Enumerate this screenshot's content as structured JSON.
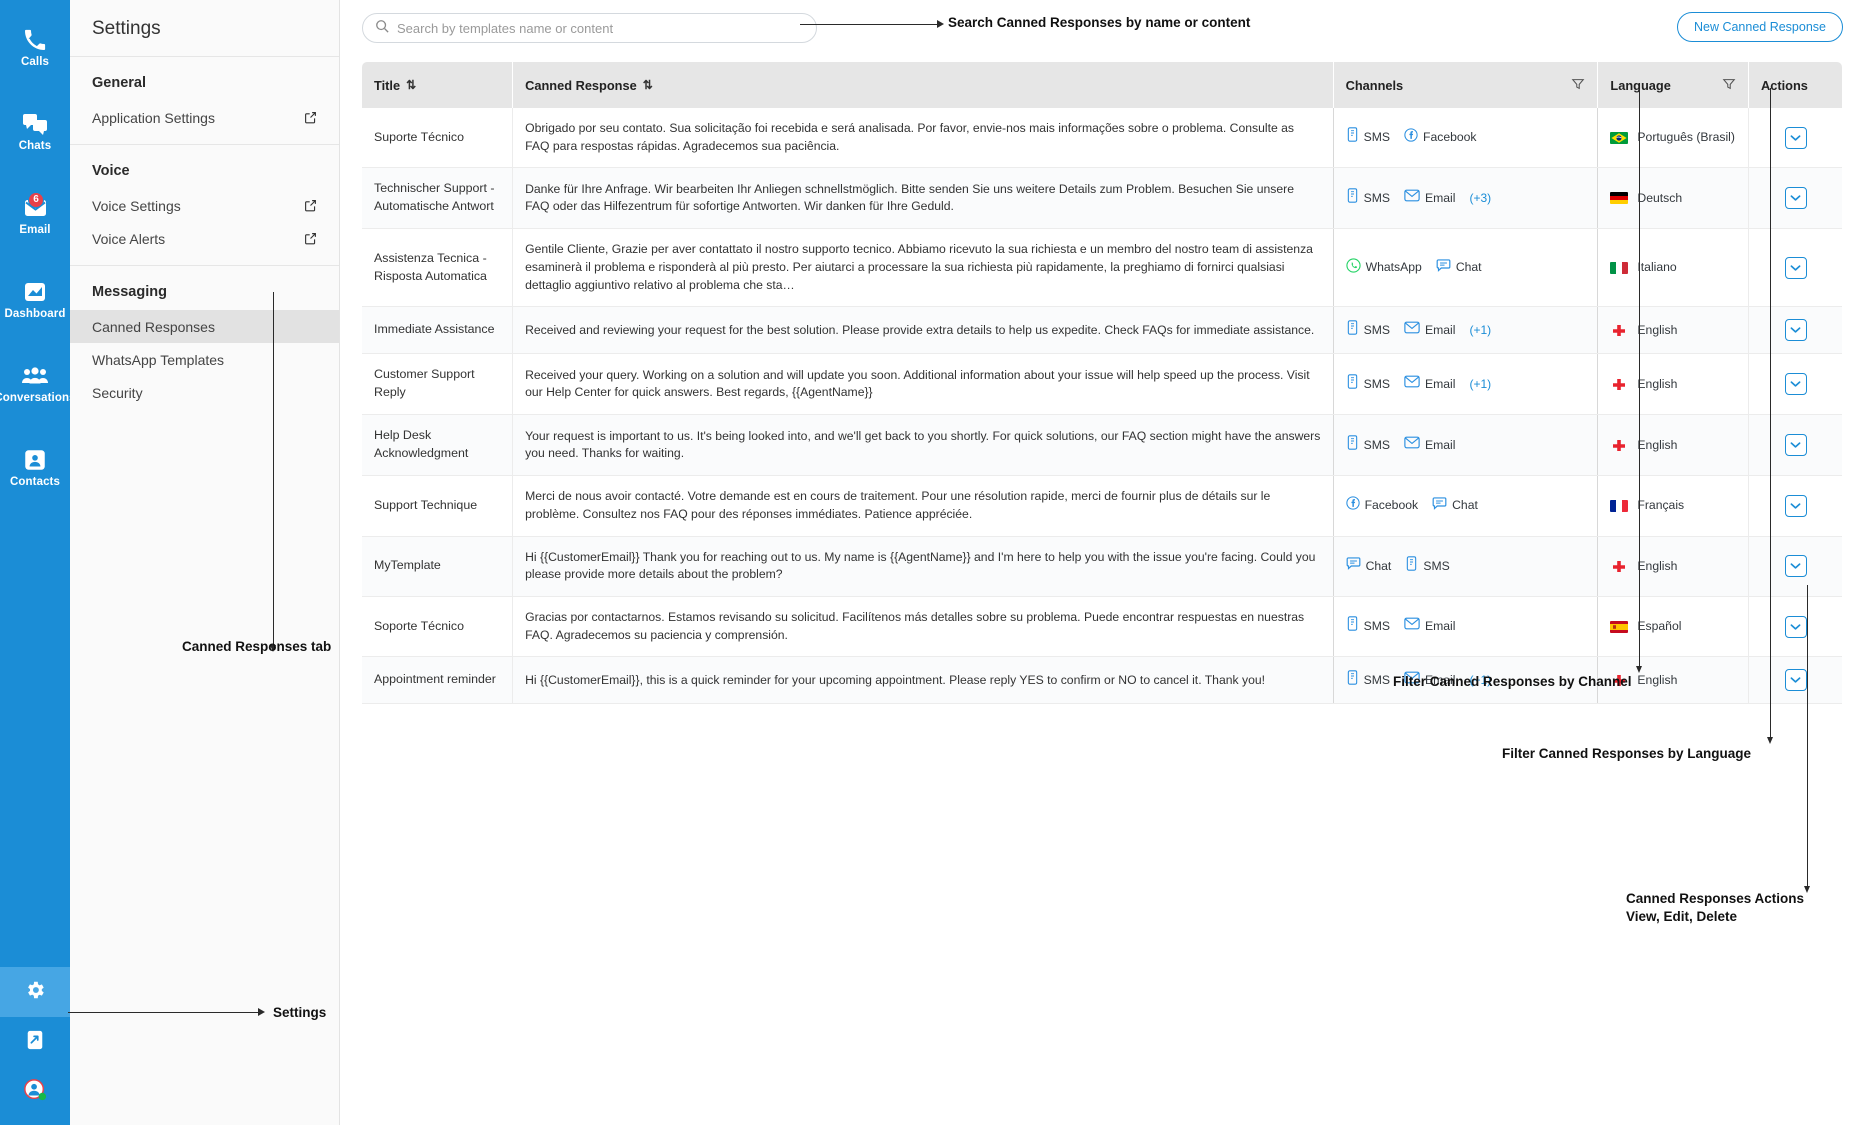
{
  "rail": {
    "items": [
      {
        "label": "Calls",
        "icon": "phone-icon",
        "badge": null
      },
      {
        "label": "Chats",
        "icon": "chat-bubbles-icon",
        "badge": null
      },
      {
        "label": "Email",
        "icon": "envelope-icon",
        "badge": "6"
      },
      {
        "label": "Dashboard",
        "icon": "dashboard-icon",
        "badge": null
      },
      {
        "label": "Conversations",
        "icon": "people-icon",
        "badge": null
      },
      {
        "label": "Contacts",
        "icon": "contact-card-icon",
        "badge": null
      }
    ],
    "bottom": [
      {
        "icon": "gear-icon",
        "name": "settings"
      },
      {
        "icon": "logout-icon",
        "name": "logout"
      },
      {
        "icon": "user-avatar-icon",
        "name": "profile"
      }
    ]
  },
  "settings": {
    "title": "Settings",
    "groups": [
      {
        "heading": "General",
        "items": [
          {
            "label": "Application Settings",
            "external": true,
            "selected": false
          }
        ]
      },
      {
        "heading": "Voice",
        "items": [
          {
            "label": "Voice Settings",
            "external": true,
            "selected": false
          },
          {
            "label": "Voice Alerts",
            "external": true,
            "selected": false
          }
        ]
      },
      {
        "heading": "Messaging",
        "items": [
          {
            "label": "Canned Responses",
            "external": false,
            "selected": true
          },
          {
            "label": "WhatsApp Templates",
            "external": false,
            "selected": false
          },
          {
            "label": "Security",
            "external": false,
            "selected": false
          }
        ]
      }
    ]
  },
  "toolbar": {
    "search_placeholder": "Search by templates name or content",
    "search_value": "",
    "search_icon": "search-icon",
    "new_button": "New Canned Response"
  },
  "table": {
    "columns": [
      {
        "label": "Title",
        "sort": true,
        "filter": false
      },
      {
        "label": "Canned Response",
        "sort": true,
        "filter": false
      },
      {
        "label": "Channels",
        "sort": false,
        "filter": true
      },
      {
        "label": "Language",
        "sort": false,
        "filter": true
      },
      {
        "label": "Actions",
        "sort": false,
        "filter": false
      }
    ],
    "rows": [
      {
        "title": "Suporte Técnico",
        "response": "Obrigado por seu contato. Sua solicitação foi recebida e será analisada. Por favor, envie-nos mais informações sobre o problema. Consulte as FAQ para respostas rápidas. Agradecemos sua paciência.",
        "channels": [
          {
            "label": "SMS",
            "icon": "sms-icon"
          },
          {
            "label": "Facebook",
            "icon": "facebook-icon"
          }
        ],
        "more": "",
        "language": "Português (Brasil)",
        "flag": "br"
      },
      {
        "title": "Technischer Support - Automatische Antwort",
        "response": "Danke für Ihre Anfrage. Wir bearbeiten Ihr Anliegen schnellstmöglich. Bitte senden Sie uns weitere Details zum Problem. Besuchen Sie unsere FAQ oder das Hilfezentrum für sofortige Antworten. Wir danken für Ihre Geduld.",
        "channels": [
          {
            "label": "SMS",
            "icon": "sms-icon"
          },
          {
            "label": "Email",
            "icon": "email-icon"
          }
        ],
        "more": "(+3)",
        "language": "Deutsch",
        "flag": "de"
      },
      {
        "title": "Assistenza Tecnica - Risposta Automatica",
        "response": "Gentile Cliente, Grazie per aver contattato il nostro supporto tecnico. Abbiamo ricevuto la sua richiesta e un membro del nostro team di assistenza esaminerà il problema e risponderà al più presto. Per aiutarci a processare la sua richiesta più rapidamente, la preghiamo di fornirci qualsiasi dettaglio aggiuntivo relativo al problema che sta…",
        "channels": [
          {
            "label": "WhatsApp",
            "icon": "whatsapp-icon"
          },
          {
            "label": "Chat",
            "icon": "chat-icon"
          }
        ],
        "more": "",
        "language": "Italiano",
        "flag": "it"
      },
      {
        "title": "Immediate Assistance",
        "response": "Received and reviewing your request for the best solution. Please provide extra details to help us expedite. Check FAQs for immediate assistance.",
        "channels": [
          {
            "label": "SMS",
            "icon": "sms-icon"
          },
          {
            "label": "Email",
            "icon": "email-icon"
          }
        ],
        "more": "(+1)",
        "language": "English",
        "flag": "en"
      },
      {
        "title": "Customer Support Reply",
        "response": "Received your query. Working on a solution and will update you soon. Additional information about your issue will help speed up the process. Visit our Help Center for quick answers. Best regards, {{AgentName}}",
        "channels": [
          {
            "label": "SMS",
            "icon": "sms-icon"
          },
          {
            "label": "Email",
            "icon": "email-icon"
          }
        ],
        "more": "(+1)",
        "language": "English",
        "flag": "en"
      },
      {
        "title": "Help Desk Acknowledgment",
        "response": "Your request is important to us. It's being looked into, and we'll get back to you shortly. For quick solutions, our FAQ section might have the answers you need. Thanks for waiting.",
        "channels": [
          {
            "label": "SMS",
            "icon": "sms-icon"
          },
          {
            "label": "Email",
            "icon": "email-icon"
          }
        ],
        "more": "",
        "language": "English",
        "flag": "en"
      },
      {
        "title": "Support Technique",
        "response": "Merci de nous avoir contacté. Votre demande est en cours de traitement. Pour une résolution rapide, merci de fournir plus de détails sur le problème. Consultez nos FAQ pour des réponses immédiates. Patience appréciée.",
        "channels": [
          {
            "label": "Facebook",
            "icon": "facebook-icon"
          },
          {
            "label": "Chat",
            "icon": "chat-icon"
          }
        ],
        "more": "",
        "language": "Français",
        "flag": "fr"
      },
      {
        "title": "MyTemplate",
        "response": "Hi {{CustomerEmail}} Thank you for reaching out to us. My name is {{AgentName}} and I'm here to help you with the issue you're facing. Could you please provide more details about the problem?",
        "channels": [
          {
            "label": "Chat",
            "icon": "chat-icon"
          },
          {
            "label": "SMS",
            "icon": "sms-icon"
          }
        ],
        "more": "",
        "language": "English",
        "flag": "en"
      },
      {
        "title": "Soporte Técnico",
        "response": "Gracias por contactarnos. Estamos revisando su solicitud. Facilítenos más detalles sobre su problema. Puede encontrar respuestas en nuestras FAQ. Agradecemos su paciencia y comprensión.",
        "channels": [
          {
            "label": "SMS",
            "icon": "sms-icon"
          },
          {
            "label": "Email",
            "icon": "email-icon"
          }
        ],
        "more": "",
        "language": "Español",
        "flag": "es"
      },
      {
        "title": "Appointment reminder",
        "response": "Hi {{CustomerEmail}}, this is a quick reminder for your upcoming appointment. Please reply YES to confirm or NO to cancel it. Thank you!",
        "channels": [
          {
            "label": "SMS",
            "icon": "sms-icon"
          },
          {
            "label": "Email",
            "icon": "email-icon"
          }
        ],
        "more": "(+1)",
        "language": "English",
        "flag": "en"
      }
    ]
  },
  "annotations": {
    "search": "Search Canned Responses by name or content",
    "tab": "Canned Responses tab",
    "settings": "Settings",
    "filter_channel": "Filter Canned Responses by Channel",
    "filter_language": "Filter Canned Responses by Language",
    "actions": "Canned Responses Actions\nView, Edit, Delete"
  },
  "colors": {
    "brand": "#1b8dd6",
    "rail_active": "#46a6e4",
    "badge": "#e8414a",
    "header_bg": "#e6e6e6",
    "selected_row": "#e2e2e2"
  }
}
